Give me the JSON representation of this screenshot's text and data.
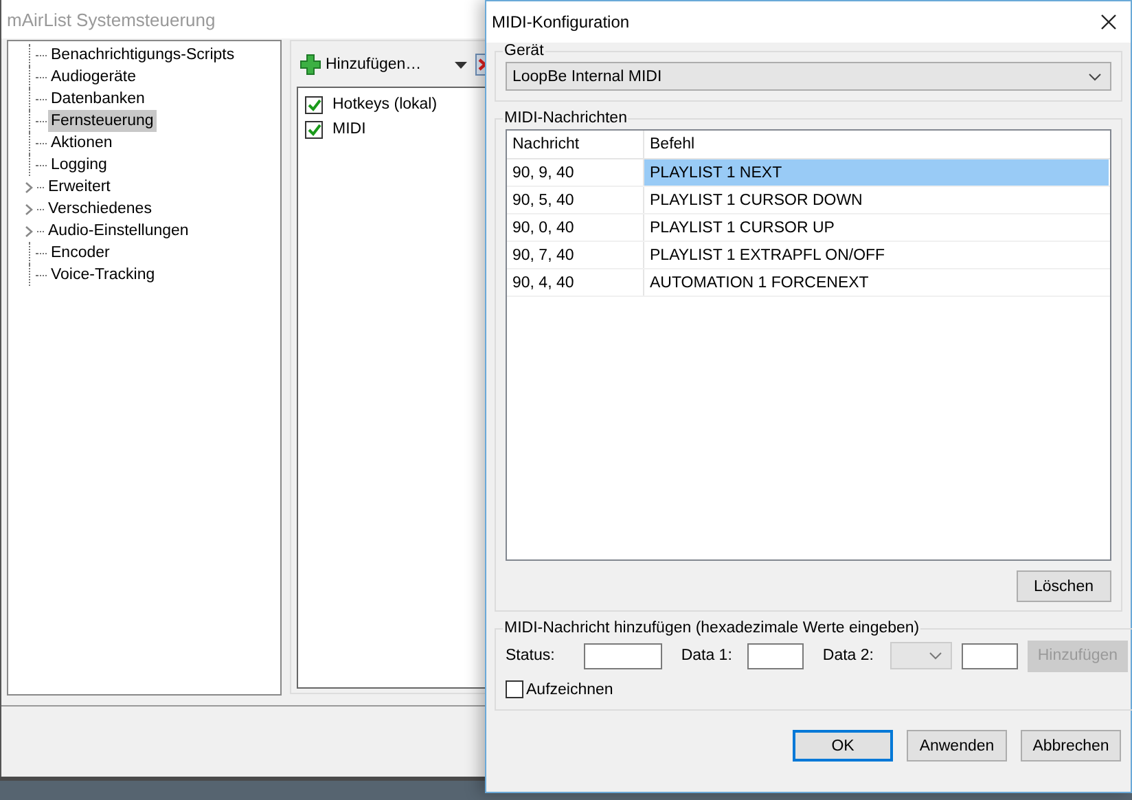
{
  "main_window": {
    "title": "mAirList Systemsteuerung",
    "tree": [
      {
        "label": "Benachrichtigungs-Scripts",
        "kind": "leaf",
        "selected": false
      },
      {
        "label": "Audiogeräte",
        "kind": "leaf",
        "selected": false
      },
      {
        "label": "Datenbanken",
        "kind": "leaf",
        "selected": false
      },
      {
        "label": "Fernsteuerung",
        "kind": "leaf",
        "selected": true
      },
      {
        "label": "Aktionen",
        "kind": "leaf",
        "selected": false
      },
      {
        "label": "Logging",
        "kind": "leaf",
        "selected": false
      },
      {
        "label": "Erweitert",
        "kind": "group",
        "selected": false
      },
      {
        "label": "Verschiedenes",
        "kind": "group",
        "selected": false
      },
      {
        "label": "Audio-Einstellungen",
        "kind": "group",
        "selected": false
      },
      {
        "label": "Encoder",
        "kind": "leaf",
        "selected": false
      },
      {
        "label": "Voice-Tracking",
        "kind": "leaf",
        "selected": false
      }
    ],
    "toolbar": {
      "add_button": "Hinzufügen…"
    },
    "remotes": [
      {
        "label": "Hotkeys (lokal)",
        "checked": true
      },
      {
        "label": "MIDI",
        "checked": true
      }
    ]
  },
  "dialog": {
    "title": "MIDI-Konfiguration",
    "device": {
      "group_label": "Gerät",
      "value": "LoopBe Internal MIDI"
    },
    "messages": {
      "group_label": "MIDI-Nachrichten",
      "columns": [
        "Nachricht",
        "Befehl"
      ],
      "rows": [
        {
          "message": "90, 9, 40",
          "command": "PLAYLIST 1 NEXT",
          "selected": true
        },
        {
          "message": "90, 5, 40",
          "command": "PLAYLIST 1 CURSOR DOWN",
          "selected": false
        },
        {
          "message": "90, 0, 40",
          "command": "PLAYLIST 1 CURSOR UP",
          "selected": false
        },
        {
          "message": "90, 7, 40",
          "command": "PLAYLIST 1 EXTRAPFL ON/OFF",
          "selected": false
        },
        {
          "message": "90, 4, 40",
          "command": "AUTOMATION 1 FORCENEXT",
          "selected": false
        }
      ],
      "delete_button": "Löschen"
    },
    "add_message": {
      "group_label": "MIDI-Nachricht hinzufügen (hexadezimale Werte eingeben)",
      "status_label": "Status:",
      "data1_label": "Data 1:",
      "data2_label": "Data 2:",
      "add_button": {
        "label": "Hinzufügen",
        "disabled": true
      },
      "record": {
        "label": "Aufzeichnen",
        "checked": false
      }
    },
    "buttons": [
      {
        "label": "OK",
        "kind": "default"
      },
      {
        "label": "Anwenden",
        "kind": "normal"
      },
      {
        "label": "Abbrechen",
        "kind": "normal"
      }
    ]
  }
}
